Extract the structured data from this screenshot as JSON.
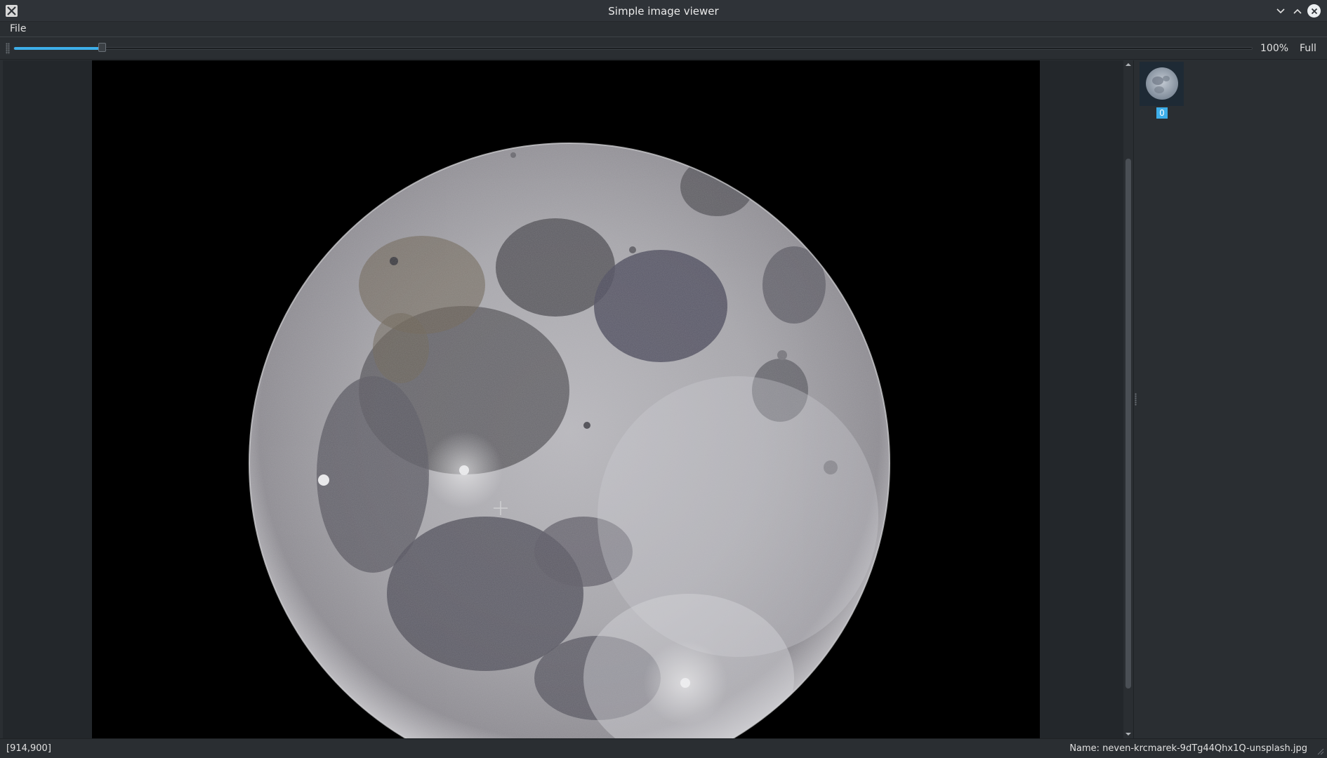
{
  "window": {
    "title": "Simple image viewer",
    "buttons": [
      "minimize-icon",
      "maximize-icon",
      "close-icon"
    ]
  },
  "menubar": {
    "items": [
      {
        "label": "File"
      }
    ]
  },
  "toolbar": {
    "zoom_slider_fraction": 0.07,
    "zoom_label": "100%",
    "full_label": "Full"
  },
  "viewer": {
    "image_description_icon": "moon-image",
    "scroll_fraction": 0.16
  },
  "thumbnails": [
    {
      "index_label": "0",
      "selected": true
    }
  ],
  "statusbar": {
    "coords": "[914,900]",
    "name": "Name: neven-krcmarek-9dTg44Qhx1Q-unsplash.jpg"
  },
  "colors": {
    "accent": "#3daee9",
    "window_bg": "#2a2e32",
    "canvas_bg": "#000000"
  }
}
